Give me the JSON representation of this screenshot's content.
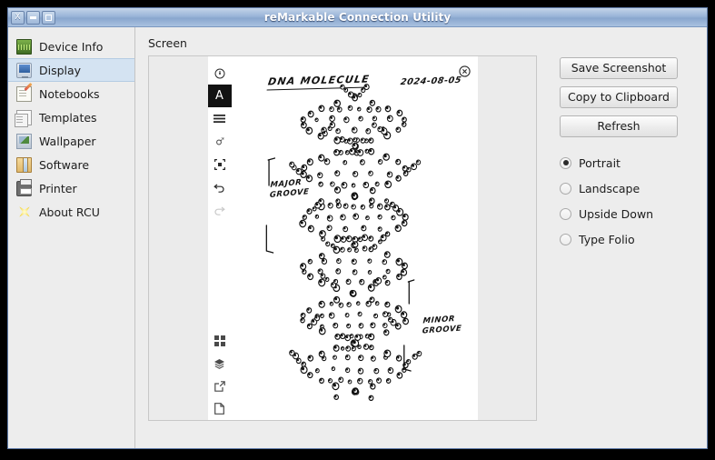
{
  "window": {
    "title": "reMarkable Connection Utility",
    "close_label": "X",
    "minimize_label": "",
    "maximize_label": ""
  },
  "sidebar": {
    "items": [
      {
        "label": "Device Info",
        "icon": "device-info-icon",
        "active": false
      },
      {
        "label": "Display",
        "icon": "display-monitor-icon",
        "active": true
      },
      {
        "label": "Notebooks",
        "icon": "notebook-pencil-icon",
        "active": false
      },
      {
        "label": "Templates",
        "icon": "templates-pages-icon",
        "active": false
      },
      {
        "label": "Wallpaper",
        "icon": "wallpaper-icon",
        "active": false
      },
      {
        "label": "Software",
        "icon": "software-book-icon",
        "active": false
      },
      {
        "label": "Printer",
        "icon": "printer-icon",
        "active": false
      },
      {
        "label": "About RCU",
        "icon": "about-star-icon",
        "active": false
      }
    ]
  },
  "main": {
    "screen_label": "Screen"
  },
  "device_preview": {
    "toolbar_top": [
      {
        "name": "history-clock-icon",
        "active": false
      },
      {
        "name": "text-tool-icon",
        "label": "A",
        "active": true
      },
      {
        "name": "layers-lines-icon",
        "active": false
      },
      {
        "name": "eraser-icon",
        "active": false
      },
      {
        "name": "selection-icon",
        "active": false
      },
      {
        "name": "undo-icon",
        "active": false
      },
      {
        "name": "redo-icon",
        "active": false,
        "disabled": true
      }
    ],
    "toolbar_bottom": [
      {
        "name": "grid-view-icon"
      },
      {
        "name": "layers-stack-icon"
      },
      {
        "name": "share-export-icon"
      },
      {
        "name": "new-page-icon"
      }
    ],
    "close_icon": "close-circle-icon",
    "note": {
      "title": "DNA MOLECULE",
      "date": "2024-08-05",
      "annotation_major": "MAJOR\nGROOVE",
      "annotation_major_line1": "MAJOR",
      "annotation_major_line2": "GROOVE",
      "annotation_minor_line1": "MINOR",
      "annotation_minor_line2": "GROOVE"
    }
  },
  "controls": {
    "buttons": [
      {
        "label": "Save Screenshot",
        "name": "save-screenshot-button"
      },
      {
        "label": "Copy to Clipboard",
        "name": "copy-to-clipboard-button"
      },
      {
        "label": "Refresh",
        "name": "refresh-button"
      }
    ],
    "orientation_options": [
      {
        "label": "Portrait",
        "selected": true
      },
      {
        "label": "Landscape",
        "selected": false
      },
      {
        "label": "Upside Down",
        "selected": false
      },
      {
        "label": "Type Folio",
        "selected": false
      }
    ]
  },
  "colors": {
    "titlebar_blue": "#9ab4d8",
    "sidebar_active": "#d4e3f2",
    "window_bg": "#ededed",
    "preview_bg": "#ebebeb",
    "ink": "#111111"
  }
}
